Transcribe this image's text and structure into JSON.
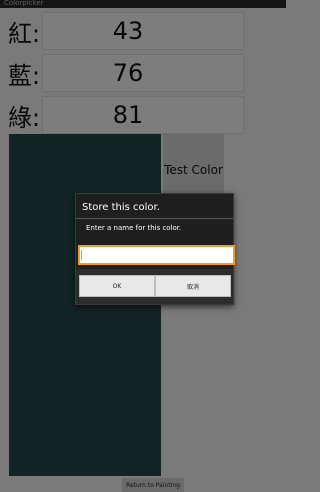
{
  "status_bar": {
    "app_label": "Colorpicker"
  },
  "rows": [
    {
      "label": "紅:",
      "value": "43"
    },
    {
      "label": "藍:",
      "value": "76"
    },
    {
      "label": "綠:",
      "value": "81"
    }
  ],
  "swatch_color": "#254a48",
  "buttons": {
    "test_color": "Test Color",
    "return_to_painting": "Return to Painting"
  },
  "dialog": {
    "title": "Store this color.",
    "message": "Enter a name for this color.",
    "input_value": "",
    "ok_label": "OK",
    "cancel_label": "取消",
    "accent_color": "#f0a020"
  }
}
